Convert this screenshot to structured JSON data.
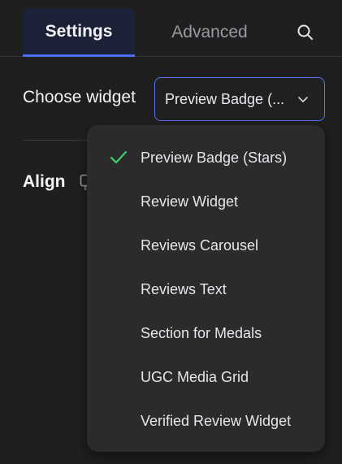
{
  "tabs": [
    {
      "label": "Settings",
      "active": true
    },
    {
      "label": "Advanced",
      "active": false
    }
  ],
  "search": {
    "icon": "search-icon"
  },
  "widget_select": {
    "label": "Choose widget",
    "value": "Preview Badge (...",
    "icon": "chevron-down-icon"
  },
  "align": {
    "label": "Align",
    "icon": "responsive-icon"
  },
  "dropdown": {
    "selected_index": 0,
    "check_icon": "check-icon",
    "options": [
      {
        "label": "Preview Badge (Stars)"
      },
      {
        "label": "Review Widget"
      },
      {
        "label": "Reviews Carousel"
      },
      {
        "label": "Reviews Text"
      },
      {
        "label": "Section for Medals"
      },
      {
        "label": "UGC Media Grid"
      },
      {
        "label": "Verified Review Widget"
      }
    ]
  },
  "colors": {
    "background": "#1f1f1f",
    "accent": "#4d6df2",
    "check": "#3fcf6f",
    "dropdown_bg": "#2b2b2b"
  }
}
